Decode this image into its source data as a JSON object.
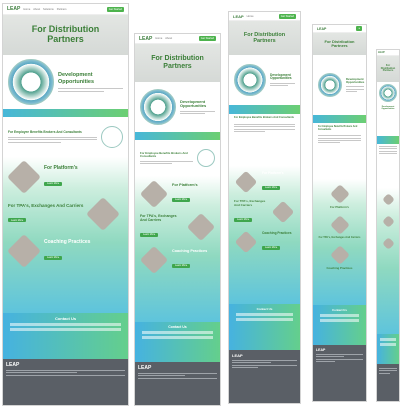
{
  "brand": {
    "logo": "LEAP",
    "accent": "#3b7f38",
    "gradient_start": "#47b7d9",
    "gradient_end": "#6ccf72"
  },
  "nav": {
    "links": [
      "Home",
      "About",
      "Solutions",
      "Partners",
      "Contact"
    ],
    "cta": "Get Started"
  },
  "hero": {
    "title": "For Distribution Partners"
  },
  "opportunities": {
    "title": "Development Opportunities"
  },
  "employee_benefits": {
    "title": "For Employee Benefits Brokers And Consultants"
  },
  "platforms": {
    "title": "For Platform's"
  },
  "tpa": {
    "title": "For TPA's, Exchanges And Carriers"
  },
  "coaching": {
    "title": "Coaching Practices"
  },
  "contact": {
    "title": "Contact Us"
  },
  "button_label": "Learn More",
  "frames": [
    "desktop",
    "laptop",
    "tablet",
    "tablet-small",
    "mobile"
  ]
}
